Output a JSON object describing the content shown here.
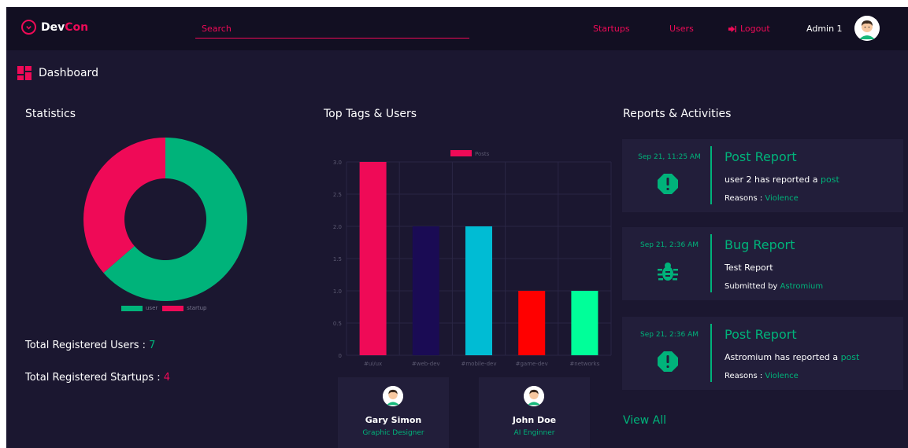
{
  "nav": {
    "brand_prefix": "Dev",
    "brand_suffix": "Con",
    "search_placeholder": "Search",
    "links": {
      "startups": "Startups",
      "users": "Users",
      "logout": "Logout"
    },
    "admin_name": "Admin 1"
  },
  "page": {
    "title": "Dashboard"
  },
  "statistics": {
    "title": "Statistics",
    "total_users_label": "Total Registered Users :",
    "total_users_value": "7",
    "total_startups_label": "Total Registered Startups :",
    "total_startups_value": "4",
    "legend": {
      "user": "user",
      "startup": "startup"
    },
    "colors": {
      "user": "#00b37a",
      "startup": "#ef0a57"
    }
  },
  "top_tags": {
    "title": "Top Tags & Users",
    "legend": "Posts",
    "users": [
      {
        "name": "Gary Simon",
        "role": "Graphic Designer"
      },
      {
        "name": "John Doe",
        "role": "AI Enginner"
      }
    ]
  },
  "chart_data": [
    {
      "type": "pie",
      "variant": "donut",
      "categories": [
        "user",
        "startup"
      ],
      "values": [
        7,
        4
      ],
      "colors": [
        "#00b37a",
        "#ef0a57"
      ],
      "legend_position": "bottom"
    },
    {
      "type": "bar",
      "categories": [
        "#ui/ux",
        "#web-dev",
        "#mobile-dev",
        "#game-dev",
        "#networks"
      ],
      "series": [
        {
          "name": "Posts",
          "values": [
            3,
            2,
            2,
            1,
            1
          ]
        }
      ],
      "bar_colors": [
        "#ef0a57",
        "#1a0b54",
        "#00bcd4",
        "#ff0000",
        "#00ff99"
      ],
      "ylim": [
        0,
        3
      ],
      "yticks": [
        "0",
        "0.5",
        "1.0",
        "1.5",
        "2.0",
        "2.5",
        "3.0"
      ],
      "grid": true,
      "legend_position": "top"
    }
  ],
  "reports": {
    "title": "Reports & Activities",
    "view_all": "View All",
    "items": [
      {
        "date": "Sep 21, 11:25 AM",
        "icon": "alert-octagon-icon",
        "title": "Post Report",
        "line1_text": "user 2 has reported a ",
        "line1_link": "post",
        "line2_label": "Reasons : ",
        "line2_value": "Violence"
      },
      {
        "date": "Sep 21, 2:36 AM",
        "icon": "bug-icon",
        "title": "Bug Report",
        "line1_text": "Test Report",
        "line1_link": "",
        "line2_label": "Submitted by ",
        "line2_value": "Astromium"
      },
      {
        "date": "Sep 21, 2:36 AM",
        "icon": "alert-octagon-icon",
        "title": "Post Report",
        "line1_text": "Astromium has reported a ",
        "line1_link": "post",
        "line2_label": "Reasons : ",
        "line2_value": "Violence"
      }
    ]
  }
}
